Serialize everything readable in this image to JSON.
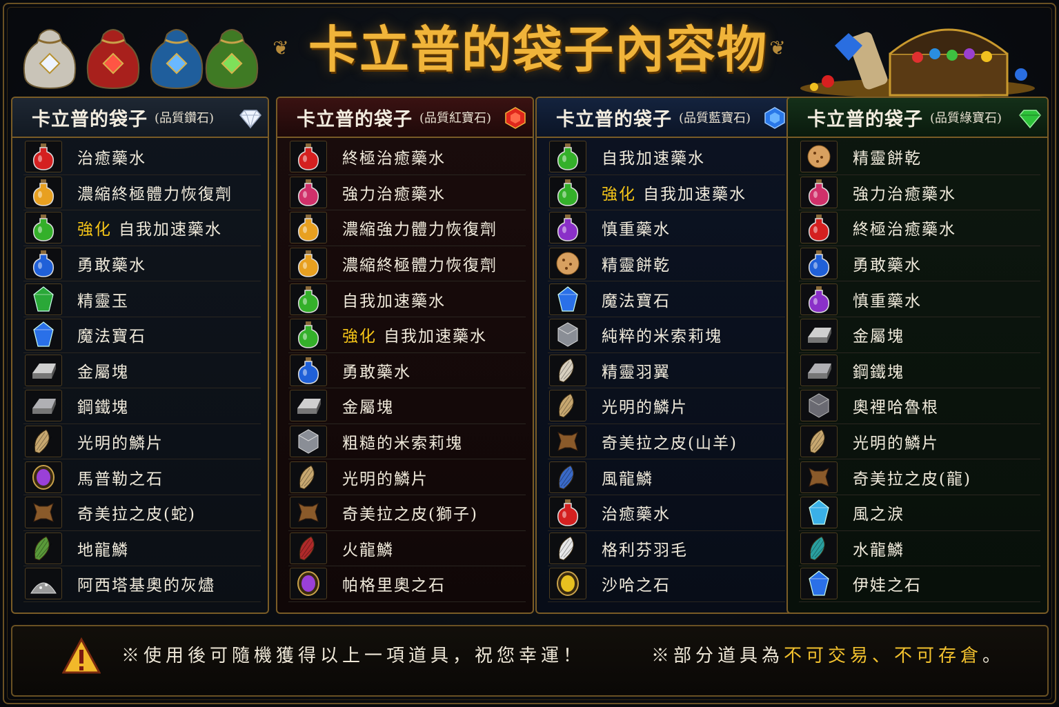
{
  "header": {
    "title": "卡立普的袋子內容物"
  },
  "columns": [
    {
      "name": "卡立普的袋子",
      "quality": "(品質鑽石)",
      "gem_color": "#e8f0ff",
      "items": [
        {
          "icon": "red-potion-icon",
          "hl": "",
          "label": "治癒藥水"
        },
        {
          "icon": "orange-potion-icon",
          "hl": "",
          "label": "濃縮終極體力恢復劑"
        },
        {
          "icon": "green-potion-icon",
          "hl": "強化",
          "label": "自我加速藥水"
        },
        {
          "icon": "blue-potion-icon",
          "hl": "",
          "label": "勇敢藥水"
        },
        {
          "icon": "green-gem-icon",
          "hl": "",
          "label": "精靈玉"
        },
        {
          "icon": "blue-crystal-icon",
          "hl": "",
          "label": "魔法寶石"
        },
        {
          "icon": "metal-ingot-icon",
          "hl": "",
          "label": "金屬塊"
        },
        {
          "icon": "steel-ingot-icon",
          "hl": "",
          "label": "鋼鐵塊"
        },
        {
          "icon": "light-scale-icon",
          "hl": "",
          "label": "光明的鱗片"
        },
        {
          "icon": "purple-stone-icon",
          "hl": "",
          "label": "馬普勒之石"
        },
        {
          "icon": "hide-icon",
          "hl": "",
          "label": "奇美拉之皮(蛇)"
        },
        {
          "icon": "earth-dragon-scale-icon",
          "hl": "",
          "label": "地龍鱗"
        },
        {
          "icon": "ash-pile-icon",
          "hl": "",
          "label": "阿西塔基奧的灰燼"
        }
      ]
    },
    {
      "name": "卡立普的袋子",
      "quality": "(品質紅寶石)",
      "gem_color": "#e0281c",
      "items": [
        {
          "icon": "red-potion-icon",
          "hl": "",
          "label": "終極治癒藥水"
        },
        {
          "icon": "pink-potion-icon",
          "hl": "",
          "label": "強力治癒藥水"
        },
        {
          "icon": "orange-potion-icon",
          "hl": "",
          "label": "濃縮強力體力恢復劑"
        },
        {
          "icon": "orange-potion-icon",
          "hl": "",
          "label": "濃縮終極體力恢復劑"
        },
        {
          "icon": "green-potion-icon",
          "hl": "",
          "label": "自我加速藥水"
        },
        {
          "icon": "green-potion-icon",
          "hl": "強化",
          "label": "自我加速藥水"
        },
        {
          "icon": "blue-potion-icon",
          "hl": "",
          "label": "勇敢藥水"
        },
        {
          "icon": "metal-ingot-icon",
          "hl": "",
          "label": "金屬塊"
        },
        {
          "icon": "mithril-ore-icon",
          "hl": "",
          "label": "粗糙的米索莉塊"
        },
        {
          "icon": "light-scale-icon",
          "hl": "",
          "label": "光明的鱗片"
        },
        {
          "icon": "hide-icon",
          "hl": "",
          "label": "奇美拉之皮(獅子)"
        },
        {
          "icon": "fire-dragon-scale-icon",
          "hl": "",
          "label": "火龍鱗"
        },
        {
          "icon": "purple-stone-icon",
          "hl": "",
          "label": "帕格里奧之石"
        }
      ]
    },
    {
      "name": "卡立普的袋子",
      "quality": "(品質藍寶石)",
      "gem_color": "#2a78e8",
      "items": [
        {
          "icon": "green-potion-icon",
          "hl": "",
          "label": "自我加速藥水"
        },
        {
          "icon": "green-potion-icon",
          "hl": "強化",
          "label": "自我加速藥水"
        },
        {
          "icon": "purple-potion-icon",
          "hl": "",
          "label": "慎重藥水"
        },
        {
          "icon": "elven-cookie-icon",
          "hl": "",
          "label": "精靈餅乾"
        },
        {
          "icon": "blue-crystal-icon",
          "hl": "",
          "label": "魔法寶石"
        },
        {
          "icon": "mithril-ore-icon",
          "hl": "",
          "label": "純粹的米索莉塊"
        },
        {
          "icon": "feather-wing-icon",
          "hl": "",
          "label": "精靈羽翼"
        },
        {
          "icon": "light-scale-icon",
          "hl": "",
          "label": "光明的鱗片"
        },
        {
          "icon": "hide-icon",
          "hl": "",
          "label": "奇美拉之皮(山羊)"
        },
        {
          "icon": "wind-dragon-scale-icon",
          "hl": "",
          "label": "風龍鱗"
        },
        {
          "icon": "red-potion-icon",
          "hl": "",
          "label": "治癒藥水"
        },
        {
          "icon": "griffon-feather-icon",
          "hl": "",
          "label": "格利芬羽毛"
        },
        {
          "icon": "yellow-stone-icon",
          "hl": "",
          "label": "沙哈之石"
        }
      ]
    },
    {
      "name": "卡立普的袋子",
      "quality": "(品質綠寶石)",
      "gem_color": "#2ec23a",
      "items": [
        {
          "icon": "elven-cookie-icon",
          "hl": "",
          "label": "精靈餅乾"
        },
        {
          "icon": "pink-potion-icon",
          "hl": "",
          "label": "強力治癒藥水"
        },
        {
          "icon": "red-potion-icon",
          "hl": "",
          "label": "終極治癒藥水"
        },
        {
          "icon": "blue-potion-icon",
          "hl": "",
          "label": "勇敢藥水"
        },
        {
          "icon": "purple-potion-icon",
          "hl": "",
          "label": "慎重藥水"
        },
        {
          "icon": "metal-ingot-icon",
          "hl": "",
          "label": "金屬塊"
        },
        {
          "icon": "steel-ingot-icon",
          "hl": "",
          "label": "鋼鐵塊"
        },
        {
          "icon": "oriharukon-ore-icon",
          "hl": "",
          "label": "奧裡哈魯根"
        },
        {
          "icon": "light-scale-icon",
          "hl": "",
          "label": "光明的鱗片"
        },
        {
          "icon": "hide-icon",
          "hl": "",
          "label": "奇美拉之皮(龍)"
        },
        {
          "icon": "wind-tear-icon",
          "hl": "",
          "label": "風之淚"
        },
        {
          "icon": "water-dragon-scale-icon",
          "hl": "",
          "label": "水龍鱗"
        },
        {
          "icon": "blue-crystal-icon",
          "hl": "",
          "label": "伊娃之石"
        }
      ]
    }
  ],
  "footer": {
    "note1": "※使用後可隨機獲得以上一項道具，祝您幸運！",
    "note2_prefix": "※部分道具為",
    "note2_highlight": "不可交易、不可存倉",
    "note2_suffix": "。"
  },
  "colors": {
    "title_gold": "#f0b43a",
    "highlight_yellow": "#f5c518",
    "border_gold": "#7a5c26"
  }
}
